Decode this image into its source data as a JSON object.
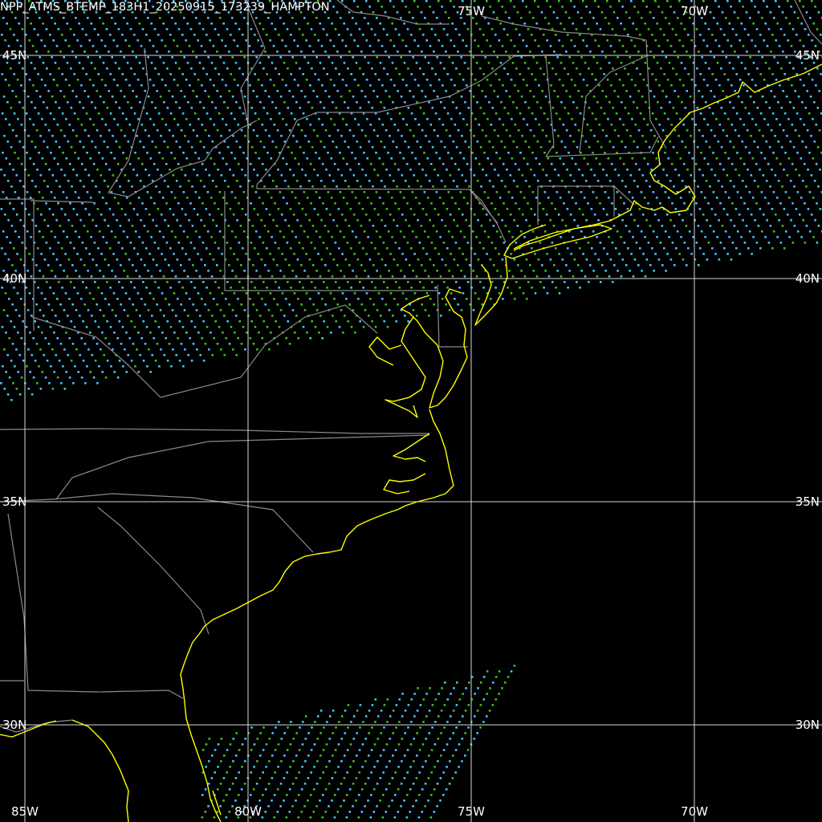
{
  "title": "NPP_ATMS_BTEMP_183H1_20250915_173239_HAMPTON",
  "grid": {
    "lon_labels": [
      "85W",
      "80W",
      "75W",
      "70W"
    ],
    "lat_labels": [
      "45N",
      "40N",
      "35N",
      "30N"
    ]
  },
  "colors": {
    "background": "#000000",
    "grid": "#d8d8d8",
    "state_borders": "#8a8a8a",
    "coastline": "#ffff00",
    "swath_cold": "#3fc6ff",
    "swath_mid": "#38c21a",
    "swath_warm": "#ffe35a",
    "swath_hot": "#ff4a1c"
  }
}
